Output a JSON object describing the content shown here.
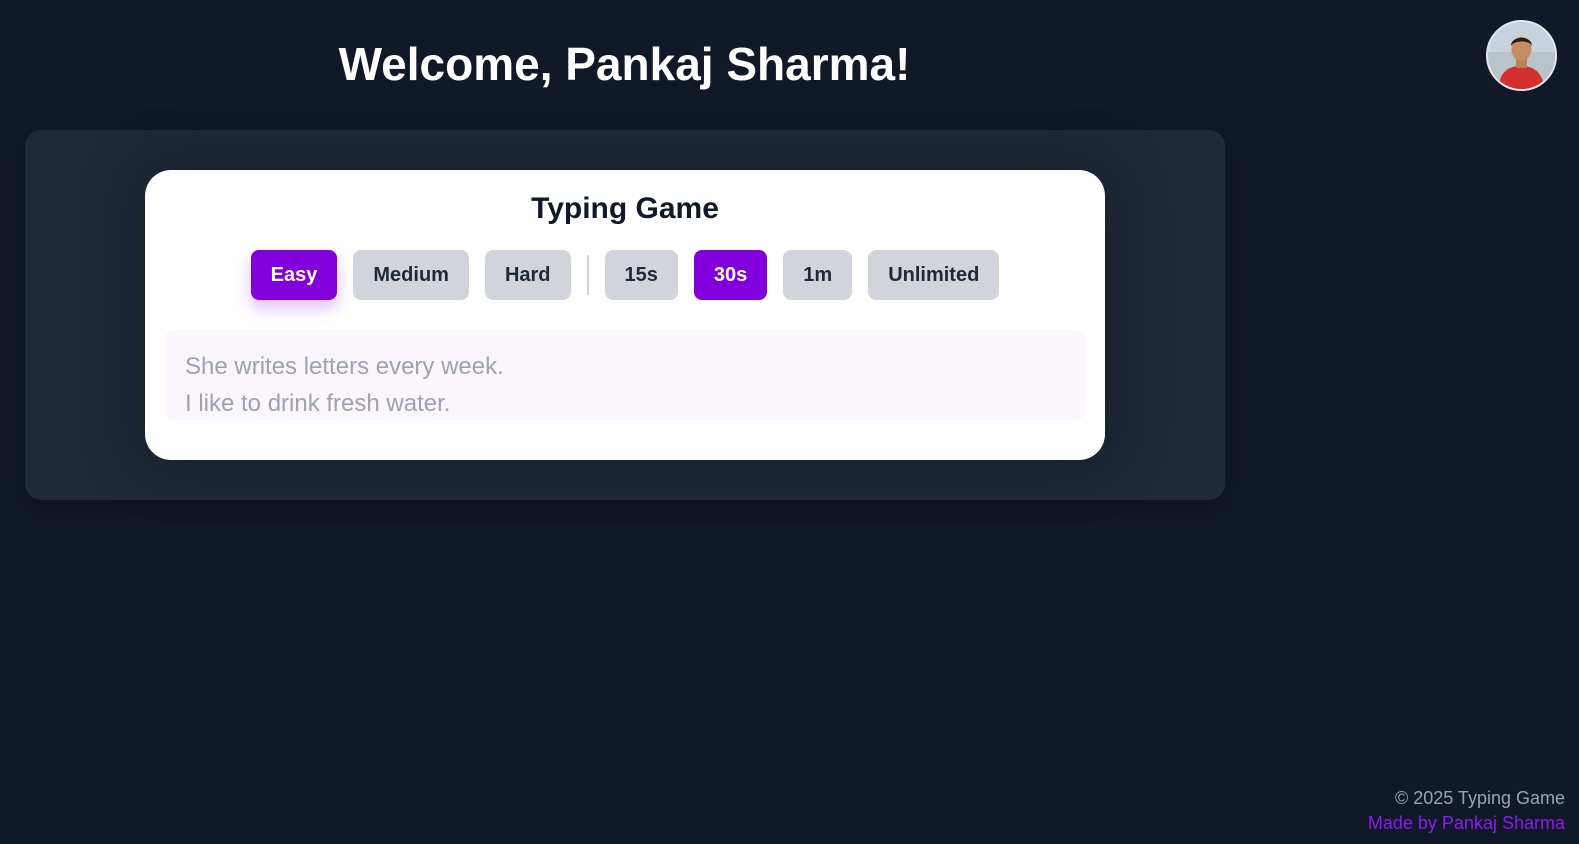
{
  "header": {
    "welcome": "Welcome, Pankaj Sharma!"
  },
  "game": {
    "title": "Typing Game",
    "difficulty": [
      {
        "label": "Easy",
        "selected": true
      },
      {
        "label": "Medium",
        "selected": false
      },
      {
        "label": "Hard",
        "selected": false
      }
    ],
    "durations": [
      {
        "label": "15s",
        "selected": false
      },
      {
        "label": "30s",
        "selected": true
      },
      {
        "label": "1m",
        "selected": false
      },
      {
        "label": "Unlimited",
        "selected": false
      }
    ],
    "text_lines": [
      "She writes letters every week.",
      "I like to drink fresh water."
    ]
  },
  "footer": {
    "copyright": "© 2025 Typing Game",
    "made_by": "Made by Pankaj Sharma"
  },
  "colors": {
    "background": "#111827",
    "panel": "#1f2937",
    "accent": "#8200db",
    "button_inactive": "#d1d5db",
    "text_area_bg": "#faf5ff"
  },
  "icons": {
    "avatar": "user-avatar-photo"
  }
}
